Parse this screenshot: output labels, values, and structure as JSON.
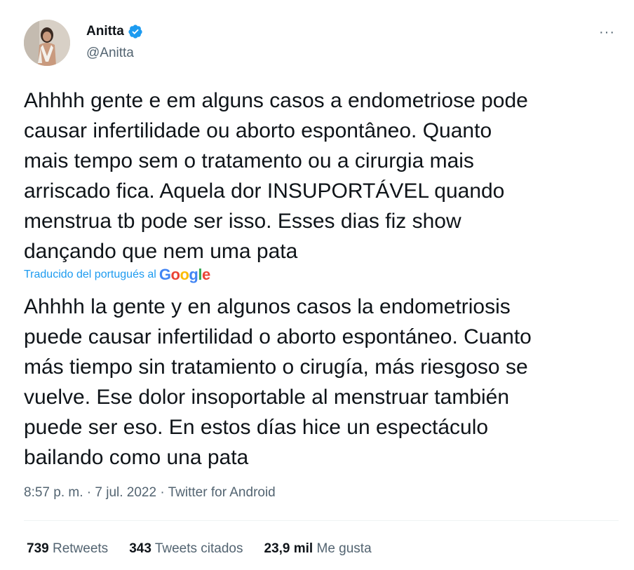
{
  "author": {
    "display_name": "Anitta",
    "handle": "@Anitta"
  },
  "menu": {
    "more_label": "···"
  },
  "tweet": {
    "text": "Ahhhh gente e em alguns casos a endometriose pode\ncausar infertilidade ou aborto espontâneo. Quanto\nmais tempo sem o tratamento ou a cirurgia mais\narriscado fica. Aquela dor INSUPORTÁVEL quando\nmenstrua tb pode ser isso. Esses dias fiz show\ndançando que nem uma pata",
    "translated_by_label": "Traducido del portugués al",
    "translator": [
      "G",
      "o",
      "o",
      "g",
      "l",
      "e"
    ],
    "translation": "Ahhhh la gente y en algunos casos la endometriosis\npuede causar infertilidad o aborto espontáneo. Cuanto\nmás tiempo sin tratamiento o cirugía, más riesgoso se\nvuelve. Ese dolor insoportable al menstruar también\npuede ser eso. En estos días hice un espectáculo\nbailando como una pata",
    "time": "8:57 p. m.",
    "separator": " · ",
    "date": "7 jul. 2022",
    "source": "Twitter for Android"
  },
  "stats": {
    "retweets": {
      "count": "739",
      "label": "Retweets"
    },
    "quotes": {
      "count": "343",
      "label": "Tweets citados"
    },
    "likes": {
      "count": "23,9 mil",
      "label": "Me gusta"
    }
  },
  "colors": {
    "accent": "#1d9bf0",
    "text": "#0f1419",
    "secondary": "#536471"
  }
}
